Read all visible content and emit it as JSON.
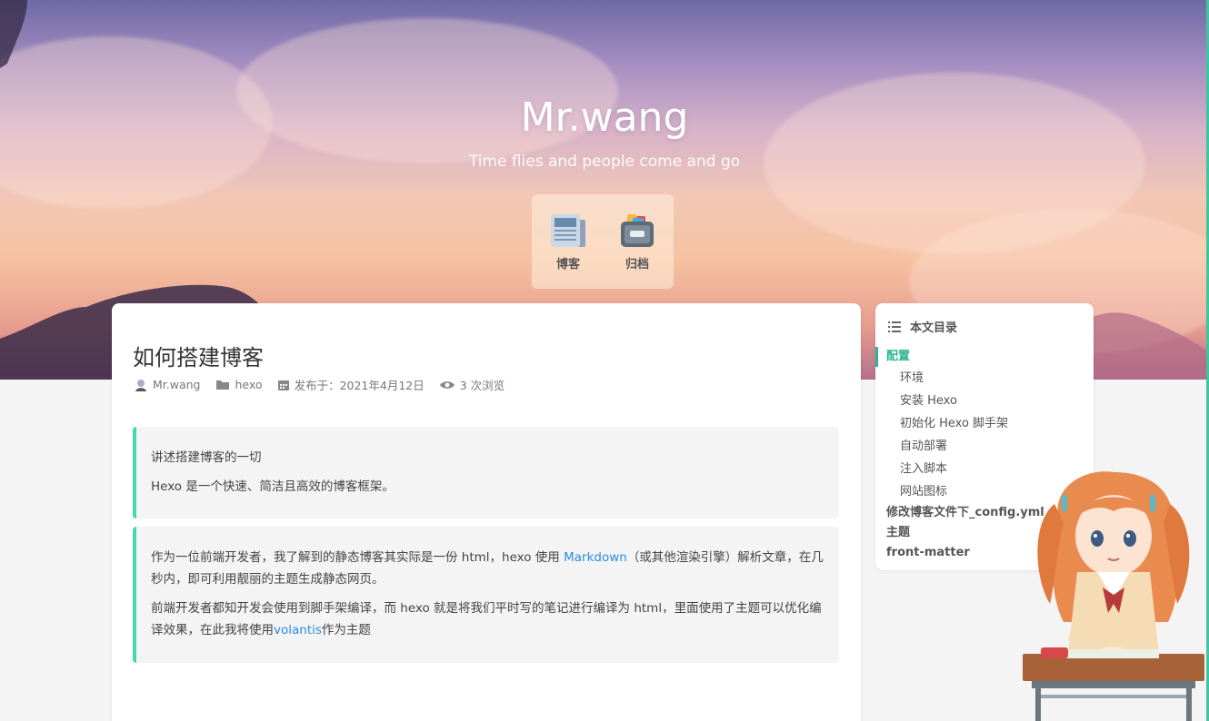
{
  "site": {
    "title": "Mr.wang",
    "subtitle": "Time flies and people come and go"
  },
  "menu": {
    "items": [
      {
        "label": "博客",
        "icon": "newspaper-icon"
      },
      {
        "label": "归档",
        "icon": "archive-box-icon"
      }
    ]
  },
  "article": {
    "title": "如何搭建博客",
    "meta": {
      "author": "Mr.wang",
      "category": "hexo",
      "published": "发布于：2021年4月12日",
      "views": "3 次浏览"
    },
    "quote1": {
      "line1": "讲述搭建博客的一切",
      "line2": "Hexo 是一个快速、简洁且高效的博客框架。"
    },
    "quote2": {
      "p1_a": "作为一位前端开发者，我了解到的静态博客其实际是一份 html，hexo 使用 ",
      "p1_link": "Markdown",
      "p1_b": "（或其他渲染引擎）解析文章，在几秒内，即可利用靓丽的主题生成静态网页。",
      "p2_a": "前端开发者都知开发会使用到脚手架编译，而 hexo 就是将我们平时写的笔记进行编译为 html，里面使用了主题可以优化编译效果，在此我将使用",
      "p2_link": "volantis",
      "p2_b": "作为主题"
    }
  },
  "toc": {
    "title": "本文目录",
    "items": [
      {
        "label": "配置",
        "level": 1,
        "active": true
      },
      {
        "label": "环境",
        "level": 2
      },
      {
        "label": "安装 Hexo",
        "level": 2
      },
      {
        "label": "初始化 Hexo 脚手架",
        "level": 2
      },
      {
        "label": "自动部署",
        "level": 2
      },
      {
        "label": "注入脚本",
        "level": 2
      },
      {
        "label": "网站图标",
        "level": 2
      },
      {
        "label": "修改博客文件下_config.yml",
        "level": 1
      },
      {
        "label": "主题",
        "level": 1
      },
      {
        "label": "front-matter",
        "level": 1
      }
    ]
  },
  "colors": {
    "accent": "#44d7b6",
    "link": "#2a8de0",
    "toc_active": "#2bb594"
  }
}
